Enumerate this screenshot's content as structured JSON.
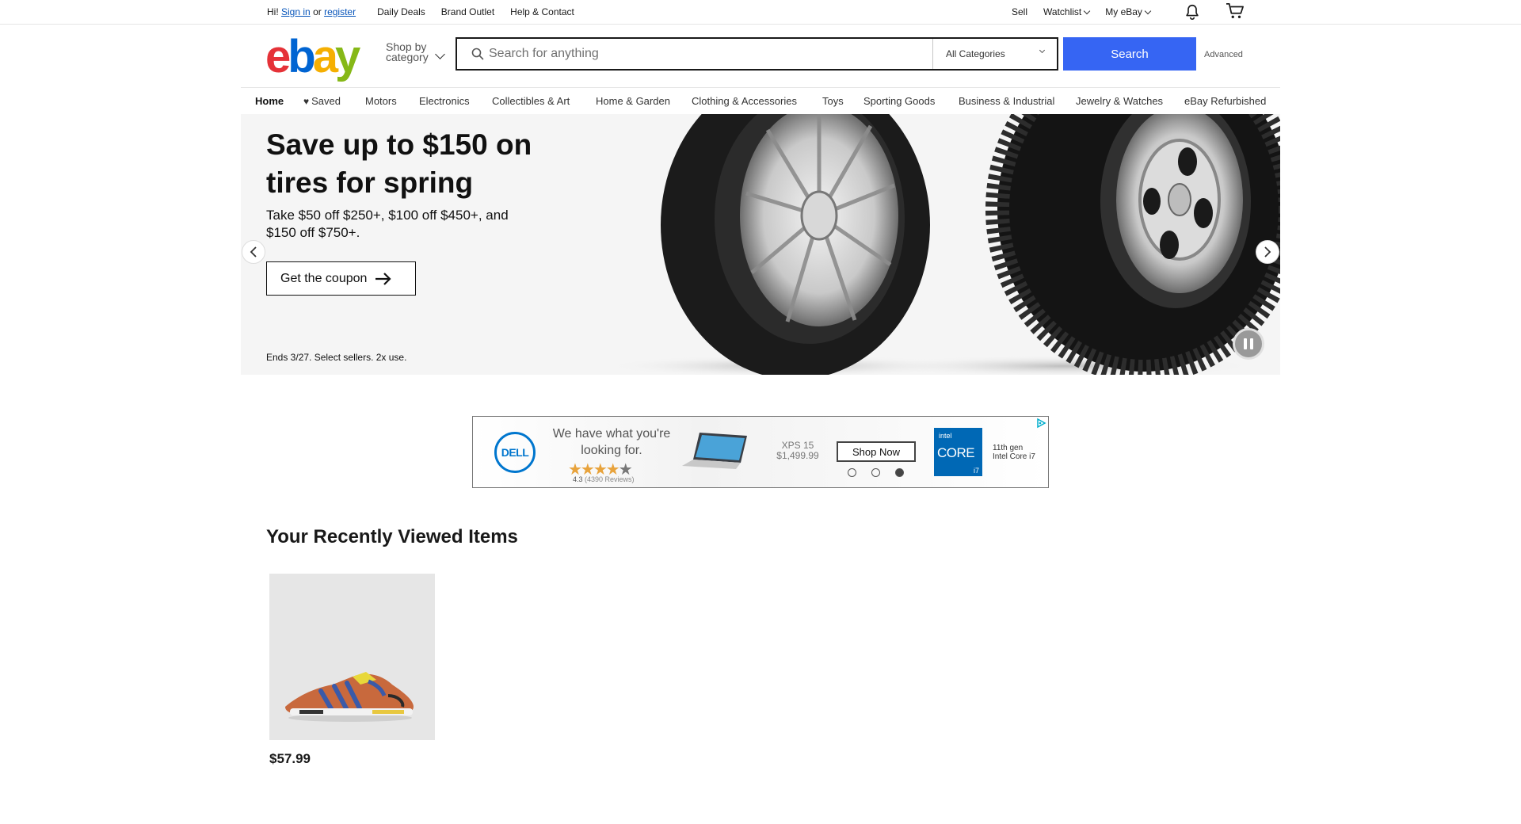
{
  "topbar": {
    "greeting": "Hi!",
    "sign_in": "Sign in",
    "or": "or",
    "register": "register",
    "nav": [
      "Daily Deals",
      "Brand Outlet",
      "Help & Contact"
    ],
    "right": {
      "sell": "Sell",
      "watchlist": "Watchlist",
      "myebay": "My eBay"
    },
    "icons": {
      "notifications": "bell-icon",
      "cart": "cart-icon"
    }
  },
  "header": {
    "logo": {
      "e": "e",
      "b": "b",
      "a": "a",
      "y": "y"
    },
    "shop_by_line1": "Shop by",
    "shop_by_line2": "category",
    "search_placeholder": "Search for anything",
    "search_value": "",
    "category_selected": "All Categories",
    "search_button": "Search",
    "advanced": "Advanced"
  },
  "catnav": {
    "items": [
      "Home",
      "Saved",
      "Motors",
      "Electronics",
      "Collectibles & Art",
      "Home & Garden",
      "Clothing & Accessories",
      "Toys",
      "Sporting Goods",
      "Business & Industrial",
      "Jewelry & Watches",
      "eBay Refurbished"
    ],
    "active": "Home"
  },
  "hero": {
    "title": "Save up to $150 on tires for spring",
    "subtitle": "Take $50 off $250+, $100 off $450+, and $150 off $750+.",
    "cta": "Get the coupon",
    "fine_print": "Ends 3/27. Select sellers. 2x use."
  },
  "ad": {
    "brand": "DELL",
    "tagline": "We have what you're looking for.",
    "rating": "4.3",
    "reviews": "(4390 Reviews)",
    "model": "XPS 15",
    "price": "$1,499.99",
    "cta": "Shop Now",
    "intel_brand": "intel",
    "intel_core": "CORE",
    "intel_tier": "i7",
    "gen_line1": "11th gen",
    "gen_line2": "Intel Core i7",
    "slides_total": 3,
    "slide_active": 3
  },
  "recently_viewed": {
    "title": "Your Recently Viewed Items",
    "items": [
      {
        "price": "$57.99"
      }
    ]
  }
}
